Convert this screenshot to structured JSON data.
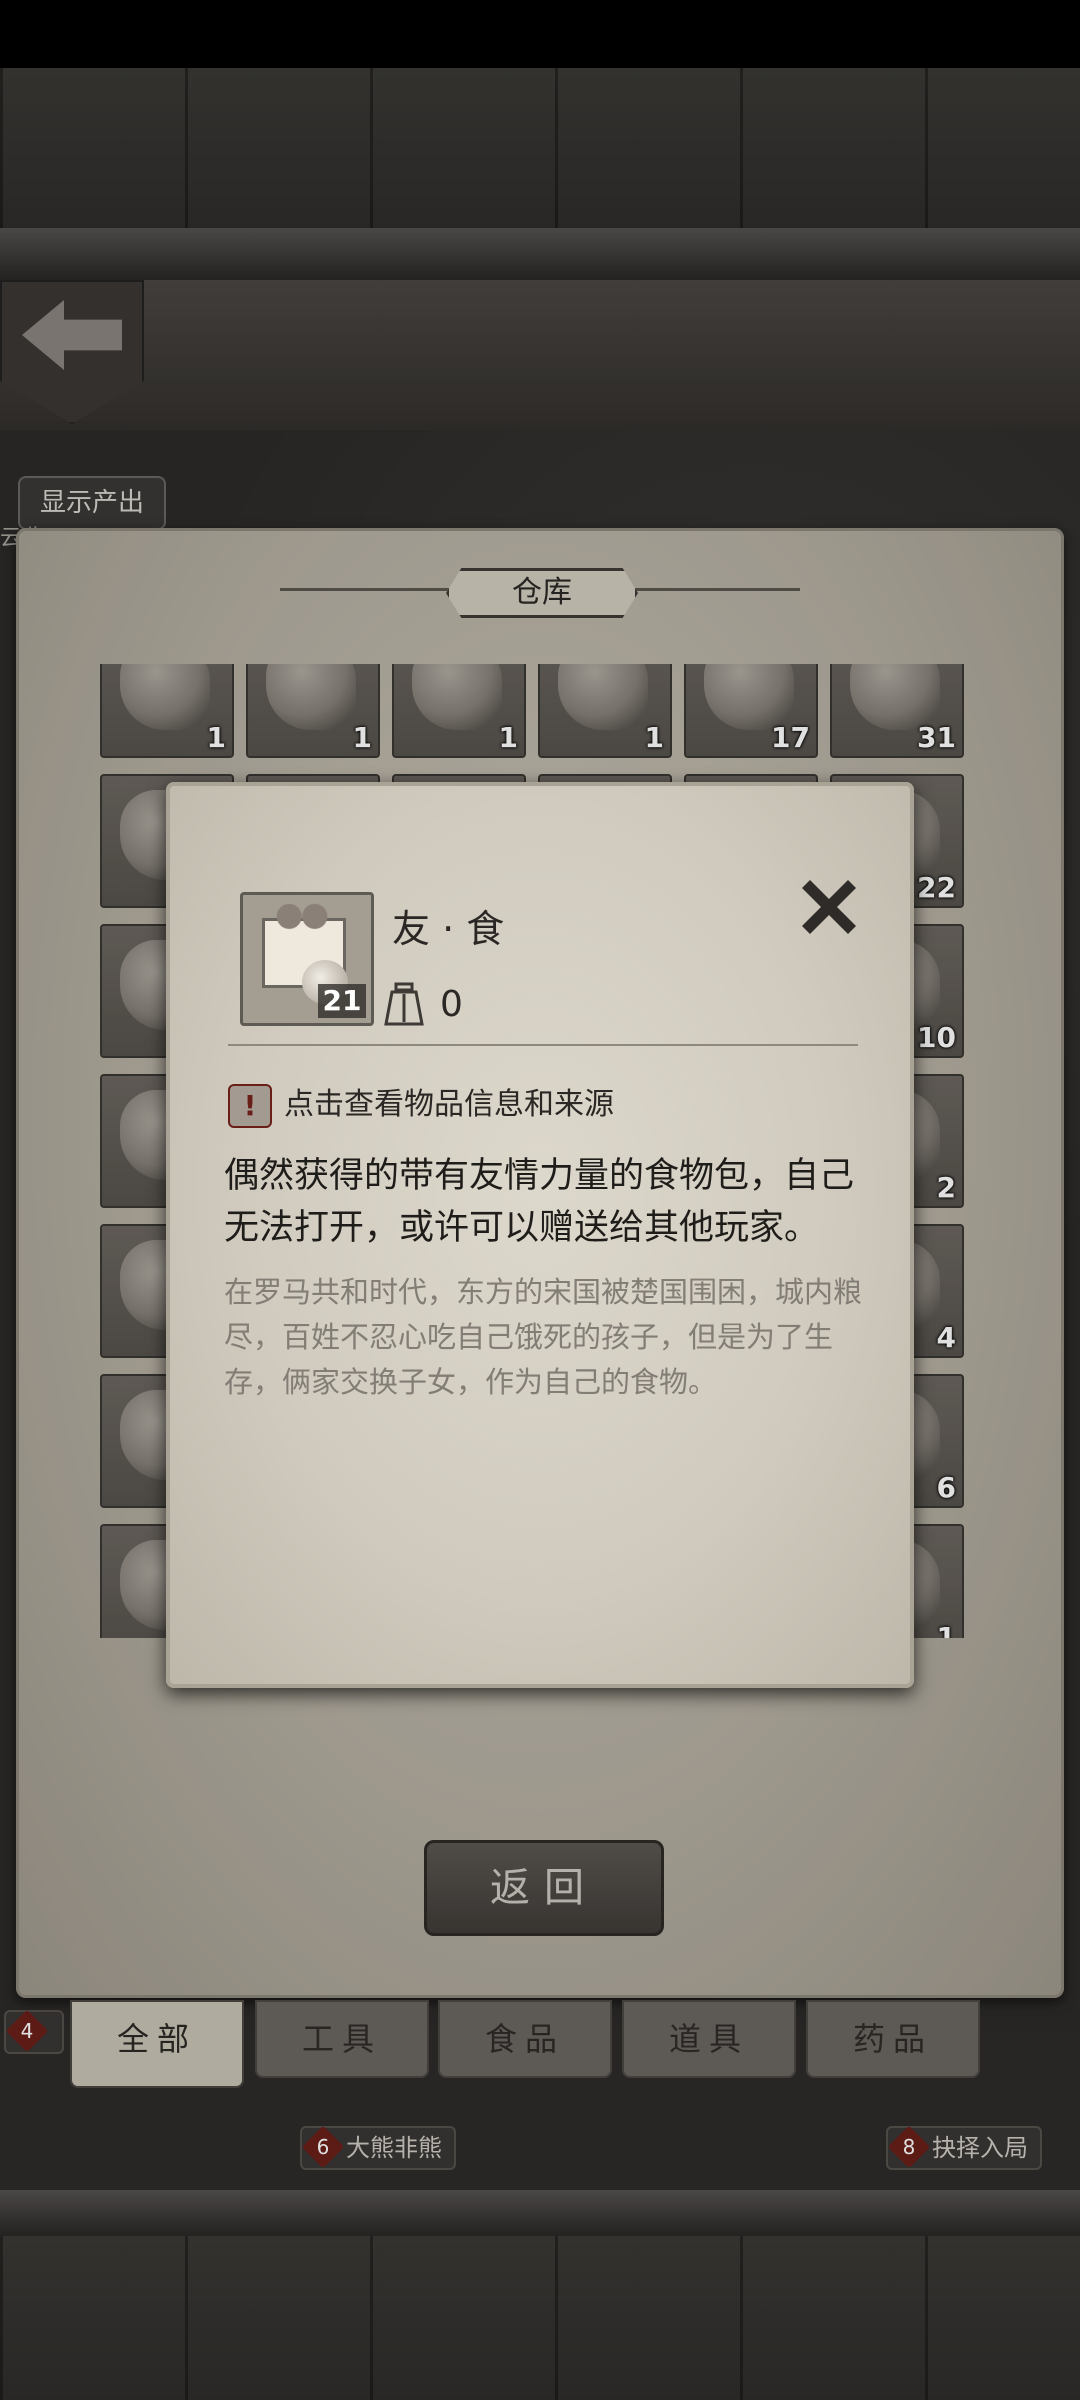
{
  "map": {
    "show_output_label": "显示产出",
    "side_text": "云收",
    "locations": [
      {
        "num": "4",
        "name": ""
      },
      {
        "num": "6",
        "name": "大熊非熊"
      },
      {
        "num": "8",
        "name": "抉择入局"
      }
    ]
  },
  "warehouse": {
    "title": "仓库",
    "slots": [
      {
        "count": "1"
      },
      {
        "count": "1"
      },
      {
        "count": "1"
      },
      {
        "count": "1"
      },
      {
        "count": "17"
      },
      {
        "count": "31"
      },
      {
        "count": ""
      },
      {
        "count": ""
      },
      {
        "count": ""
      },
      {
        "count": ""
      },
      {
        "count": ""
      },
      {
        "count": "22"
      },
      {
        "count": ""
      },
      {
        "count": ""
      },
      {
        "count": ""
      },
      {
        "count": ""
      },
      {
        "count": ""
      },
      {
        "count": "10"
      },
      {
        "count": ""
      },
      {
        "count": ""
      },
      {
        "count": ""
      },
      {
        "count": ""
      },
      {
        "count": ""
      },
      {
        "count": "2"
      },
      {
        "count": ""
      },
      {
        "count": ""
      },
      {
        "count": ""
      },
      {
        "count": ""
      },
      {
        "count": ""
      },
      {
        "count": "4"
      },
      {
        "count": ""
      },
      {
        "count": ""
      },
      {
        "count": ""
      },
      {
        "count": ""
      },
      {
        "count": ""
      },
      {
        "count": "6"
      },
      {
        "count": ""
      },
      {
        "count": ""
      },
      {
        "count": ""
      },
      {
        "count": ""
      },
      {
        "count": ""
      },
      {
        "count": "1"
      }
    ],
    "return_label": "返回",
    "tabs": [
      {
        "label": "全部",
        "active": true
      },
      {
        "label": "工具",
        "active": false
      },
      {
        "label": "食品",
        "active": false
      },
      {
        "label": "道具",
        "active": false
      },
      {
        "label": "药品",
        "active": false
      }
    ]
  },
  "popup": {
    "item_name": "友 · 食",
    "item_count": "21",
    "weight": "0",
    "info_link": "点击查看物品信息和来源",
    "description": "偶然获得的带有友情力量的食物包，自己无法打开，或许可以赠送给其他玩家。",
    "lore": "在罗马共和时代，东方的宋国被楚国围困，城内粮尽，百姓不忍心吃自己饿死的孩子，但是为了生存，俩家交换子女，作为自己的食物。",
    "icons": {
      "close": "close-icon",
      "weight": "weight-icon",
      "warning": "warning-icon"
    }
  },
  "colors": {
    "accent_warning": "#6a1e18",
    "panel": "#c9c3b5",
    "popup": "#d8d3c7"
  }
}
